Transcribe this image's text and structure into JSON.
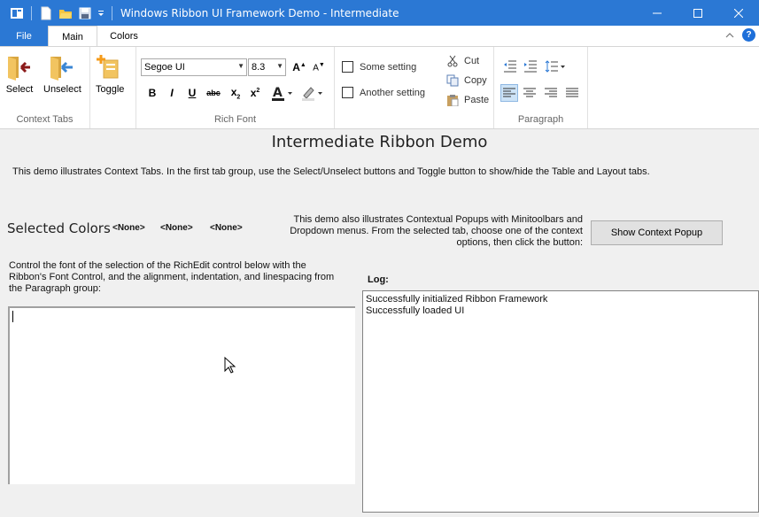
{
  "window": {
    "title": "Windows Ribbon UI Framework Demo - Intermediate",
    "controls": [
      "minimize",
      "maximize",
      "close"
    ]
  },
  "quick_access": {
    "icons": [
      "app-icon",
      "new-file-icon",
      "open-folder-icon",
      "save-icon",
      "customize-dropdown-icon"
    ]
  },
  "tabs": {
    "file": "File",
    "main": "Main",
    "colors": "Colors",
    "active": "Main"
  },
  "ribbon": {
    "context_tabs": {
      "label": "Context Tabs",
      "select": "Select",
      "unselect": "Unselect",
      "toggle": "Toggle"
    },
    "rich_font": {
      "label": "Rich Font",
      "font_family": "Segoe UI",
      "font_size": "8.3"
    },
    "settings": {
      "some_setting": "Some setting",
      "another_setting": "Another setting"
    },
    "clipboard": {
      "cut": "Cut",
      "copy": "Copy",
      "paste": "Paste"
    },
    "paragraph": {
      "label": "Paragraph",
      "active_alignment": "left"
    }
  },
  "main": {
    "title": "Intermediate Ribbon Demo",
    "description": "This demo illustrates Context Tabs. In the first tab group, use the Select/Unselect buttons and Toggle button to show/hide the Table and Layout tabs.",
    "selected_colors": {
      "label": "Selected Colors",
      "values": [
        "<None>",
        "<None>",
        "<None>"
      ]
    },
    "popup_description": "This demo also illustrates Contextual Popups with Minitoolbars and Dropdown menus. From the selected tab, choose one of the context options, then click the button:",
    "popup_button": "Show Context Popup",
    "font_description": "Control the font of the selection of the RichEdit control below with the Ribbon's Font Control, and the alignment, indentation, and linespacing from the Paragraph group:",
    "richedit_value": "",
    "log": {
      "label": "Log:",
      "lines": [
        "Successfully initialized Ribbon Framework",
        "Successfully loaded UI"
      ]
    }
  },
  "colors": {
    "titlebar": "#2b78d4",
    "accent": "#2b78d4"
  }
}
